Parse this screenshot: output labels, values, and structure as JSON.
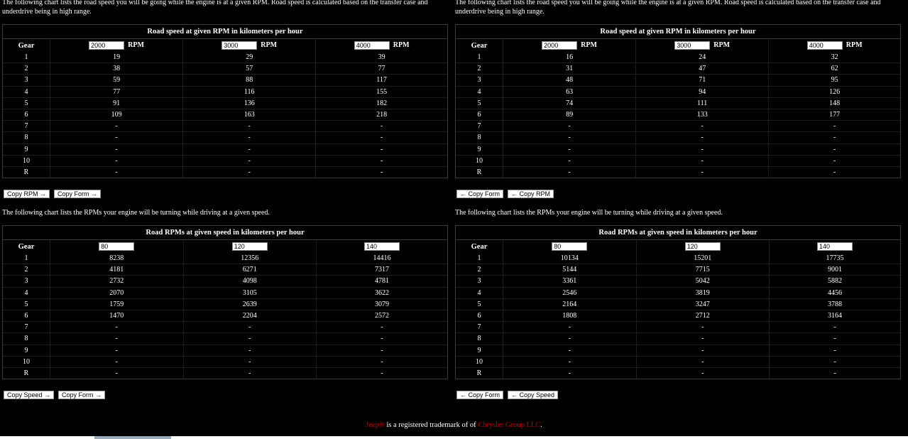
{
  "panels": [
    {
      "intro": "The following chart lists the road speed you will be going while the engine is at a given RPM. Road speed is calculated based on the transfer case and underdrive being in high range.",
      "title": "Road speed at given RPM in kilometers per hour",
      "gear_label": "Gear",
      "unit": "RPM",
      "inputs": [
        "2000",
        "3000",
        "4000"
      ],
      "rows": [
        [
          "1",
          "19",
          "29",
          "39"
        ],
        [
          "2",
          "38",
          "57",
          "77"
        ],
        [
          "3",
          "59",
          "88",
          "117"
        ],
        [
          "4",
          "77",
          "116",
          "155"
        ],
        [
          "5",
          "91",
          "136",
          "182"
        ],
        [
          "6",
          "109",
          "163",
          "218"
        ],
        [
          "7",
          "-",
          "-",
          "-"
        ],
        [
          "8",
          "-",
          "-",
          "-"
        ],
        [
          "9",
          "-",
          "-",
          "-"
        ],
        [
          "10",
          "-",
          "-",
          "-"
        ],
        [
          "R",
          "-",
          "-",
          "-"
        ]
      ],
      "buttons": [
        "Copy RPM →",
        "Copy Form →"
      ]
    },
    {
      "intro": "The following chart lists the road speed you will be going while the engine is at a given RPM. Road speed is calculated based on the transfer case and underdrive being in high range.",
      "title": "Road speed at given RPM in kilometers per hour",
      "gear_label": "Gear",
      "unit": "RPM",
      "inputs": [
        "2000",
        "3000",
        "4000"
      ],
      "rows": [
        [
          "1",
          "16",
          "24",
          "32"
        ],
        [
          "2",
          "31",
          "47",
          "62"
        ],
        [
          "3",
          "48",
          "71",
          "95"
        ],
        [
          "4",
          "63",
          "94",
          "126"
        ],
        [
          "5",
          "74",
          "111",
          "148"
        ],
        [
          "6",
          "89",
          "133",
          "177"
        ],
        [
          "7",
          "-",
          "-",
          "-"
        ],
        [
          "8",
          "-",
          "-",
          "-"
        ],
        [
          "9",
          "-",
          "-",
          "-"
        ],
        [
          "10",
          "-",
          "-",
          "-"
        ],
        [
          "R",
          "-",
          "-",
          "-"
        ]
      ],
      "buttons": [
        "← Copy Form",
        "← Copy RPM"
      ]
    },
    {
      "intro": "The following chart lists the RPMs your engine will be turning while driving at a given speed.",
      "title": "Road RPMs at given speed in kilometers per hour",
      "gear_label": "Gear",
      "unit": "",
      "inputs": [
        "80",
        "120",
        "140"
      ],
      "rows": [
        [
          "1",
          "8238",
          "12356",
          "14416"
        ],
        [
          "2",
          "4181",
          "6271",
          "7317"
        ],
        [
          "3",
          "2732",
          "4098",
          "4781"
        ],
        [
          "4",
          "2070",
          "3105",
          "3622"
        ],
        [
          "5",
          "1759",
          "2639",
          "3079"
        ],
        [
          "6",
          "1470",
          "2204",
          "2572"
        ],
        [
          "7",
          "-",
          "-",
          "-"
        ],
        [
          "8",
          "-",
          "-",
          "-"
        ],
        [
          "9",
          "-",
          "-",
          "-"
        ],
        [
          "10",
          "-",
          "-",
          "-"
        ],
        [
          "R",
          "-",
          "-",
          "-"
        ]
      ],
      "buttons": [
        "Copy Speed →",
        "Copy Form →"
      ]
    },
    {
      "intro": "The following chart lists the RPMs your engine will be turning while driving at a given speed.",
      "title": "Road RPMs at given speed in kilometers per hour",
      "gear_label": "Gear",
      "unit": "",
      "inputs": [
        "80",
        "120",
        "140"
      ],
      "rows": [
        [
          "1",
          "10134",
          "15201",
          "17735"
        ],
        [
          "2",
          "5144",
          "7715",
          "9001"
        ],
        [
          "3",
          "3361",
          "5042",
          "5882"
        ],
        [
          "4",
          "2546",
          "3819",
          "4456"
        ],
        [
          "5",
          "2164",
          "3247",
          "3788"
        ],
        [
          "6",
          "1808",
          "2712",
          "3164"
        ],
        [
          "7",
          "-",
          "-",
          "-"
        ],
        [
          "8",
          "-",
          "-",
          "-"
        ],
        [
          "9",
          "-",
          "-",
          "-"
        ],
        [
          "10",
          "-",
          "-",
          "-"
        ],
        [
          "R",
          "-",
          "-",
          "-"
        ]
      ],
      "buttons": [
        "← Copy Form",
        "← Copy Speed"
      ]
    }
  ],
  "footer": {
    "link1": "Jeep®",
    "text_mid": " is a registered trademark of of ",
    "link2": "Chrysler Group LLC",
    "text_end": "."
  }
}
